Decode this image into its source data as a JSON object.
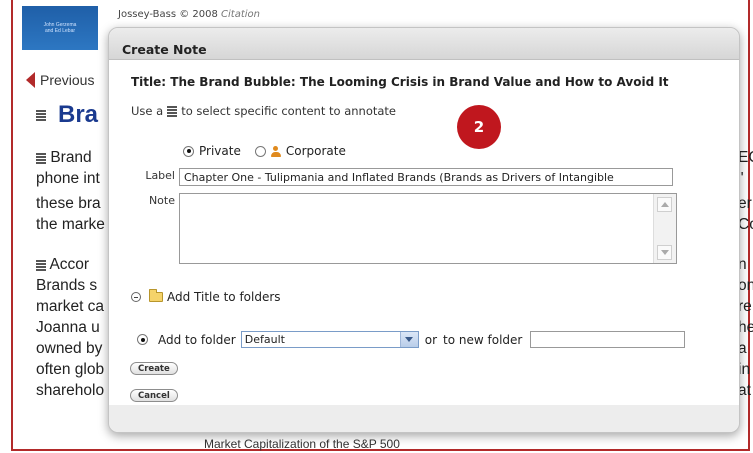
{
  "background": {
    "citation_prefix": "Jossey-Bass © 2008",
    "citation_italic": "Citation",
    "cover_lines": [
      "John Gerzema",
      "and Ed Lebar"
    ],
    "previous_label": "Previous",
    "heading_fragment": "Bra",
    "text_lines": [
      {
        "text": "Brand",
        "icon": true
      },
      {
        "text": "phone int",
        "icon": false
      },
      {
        "text": "these bra",
        "icon": false
      },
      {
        "text": "the marke",
        "icon": false
      },
      {
        "text": "Accor",
        "icon": true
      },
      {
        "text": "Brands s",
        "icon": false
      },
      {
        "text": "market ca",
        "icon": false
      },
      {
        "text": "Joanna u",
        "icon": false
      },
      {
        "text": "owned by",
        "icon": false
      },
      {
        "text": "often glob",
        "icon": false
      },
      {
        "text": "shareholo",
        "icon": false
      }
    ],
    "right_fragments": [
      "EC",
      "\"",
      "er",
      "Co",
      "n",
      "on",
      "re",
      "he",
      "a",
      "in",
      "at"
    ],
    "footer_caption": "Market Capitalization of the S&P 500"
  },
  "dialog": {
    "header_title": "Create Note",
    "book_title": "Title: The Brand Bubble: The Looming Crisis in Brand Value and How to Avoid It",
    "instruction_before": "Use a",
    "instruction_after": "to select specific content to annotate",
    "step_badge": "2",
    "visibility": {
      "private_label": "Private",
      "corporate_label": "Corporate",
      "selected": "private"
    },
    "label_field": {
      "label": "Label",
      "value": "Chapter One - Tulipmania and Inflated Brands (Brands as Drivers of Intangible"
    },
    "note_field": {
      "label": "Note",
      "value": ""
    },
    "folders_toggle_label": "Add Title to folders",
    "add_to_folder_label": "Add to folder",
    "folder_select_value": "Default",
    "or_label": "or",
    "new_folder_label": "to new folder",
    "new_folder_value": "",
    "create_label": "Create",
    "cancel_label": "Cancel"
  },
  "colors": {
    "frame_red": "#b22a2a",
    "badge_red": "#c0171e",
    "heading_blue": "#1a3a8f"
  },
  "icons": [
    "previous-arrow-icon",
    "paragraph-select-icon",
    "person-icon",
    "collapse-icon",
    "folder-icon",
    "chevron-down-icon",
    "scroll-up-icon",
    "scroll-down-icon"
  ]
}
